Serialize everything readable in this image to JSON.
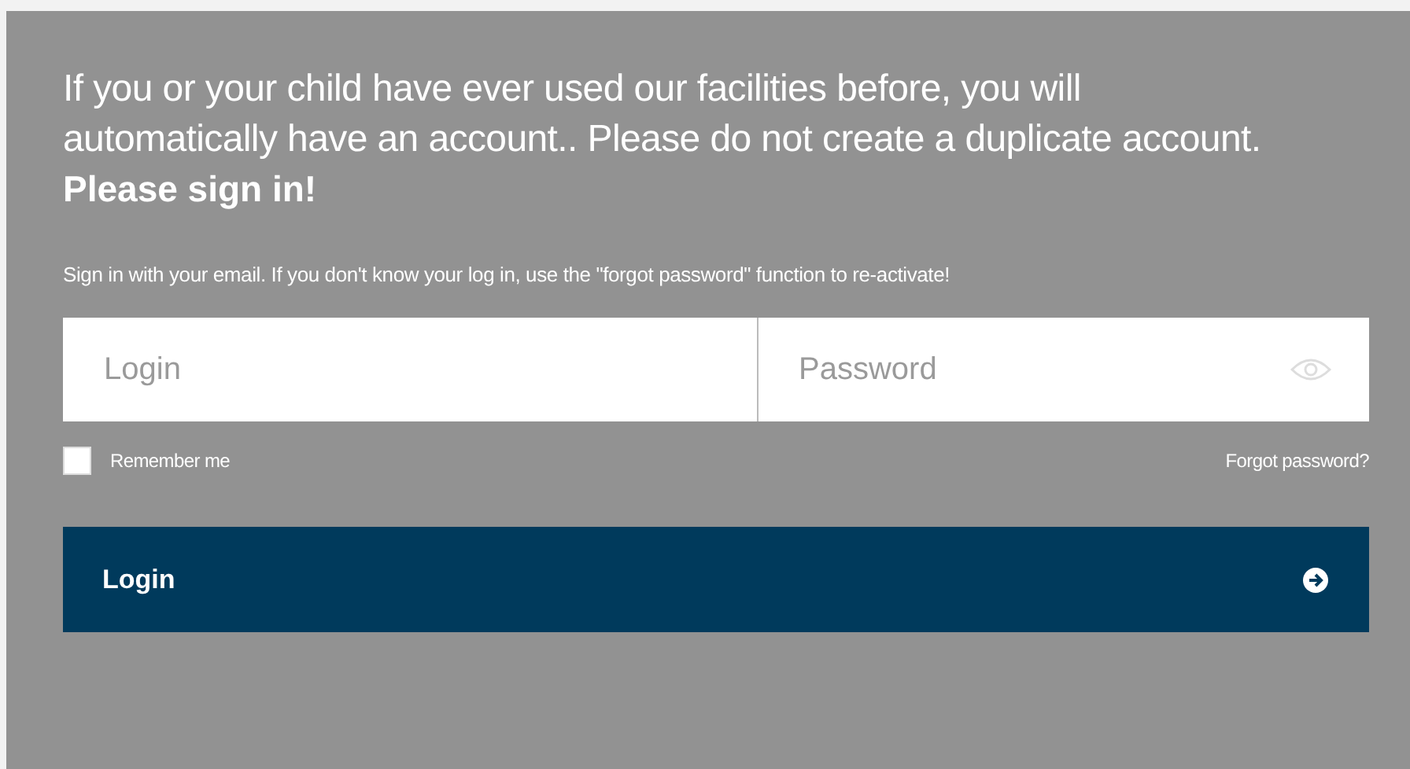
{
  "intro": "If you or your child have ever used our facilities before, you will automatically have an account.. Please do not create a duplicate account.",
  "heading": "Please sign in!",
  "hint": "Sign in with your email. If you don't know your log in, use the \"forgot password\" function to re-activate!",
  "login_field": {
    "placeholder": "Login"
  },
  "password_field": {
    "placeholder": "Password"
  },
  "remember_me": {
    "label": "Remember me",
    "checked": false
  },
  "forgot_link": "Forgot password?",
  "login_button": "Login"
}
